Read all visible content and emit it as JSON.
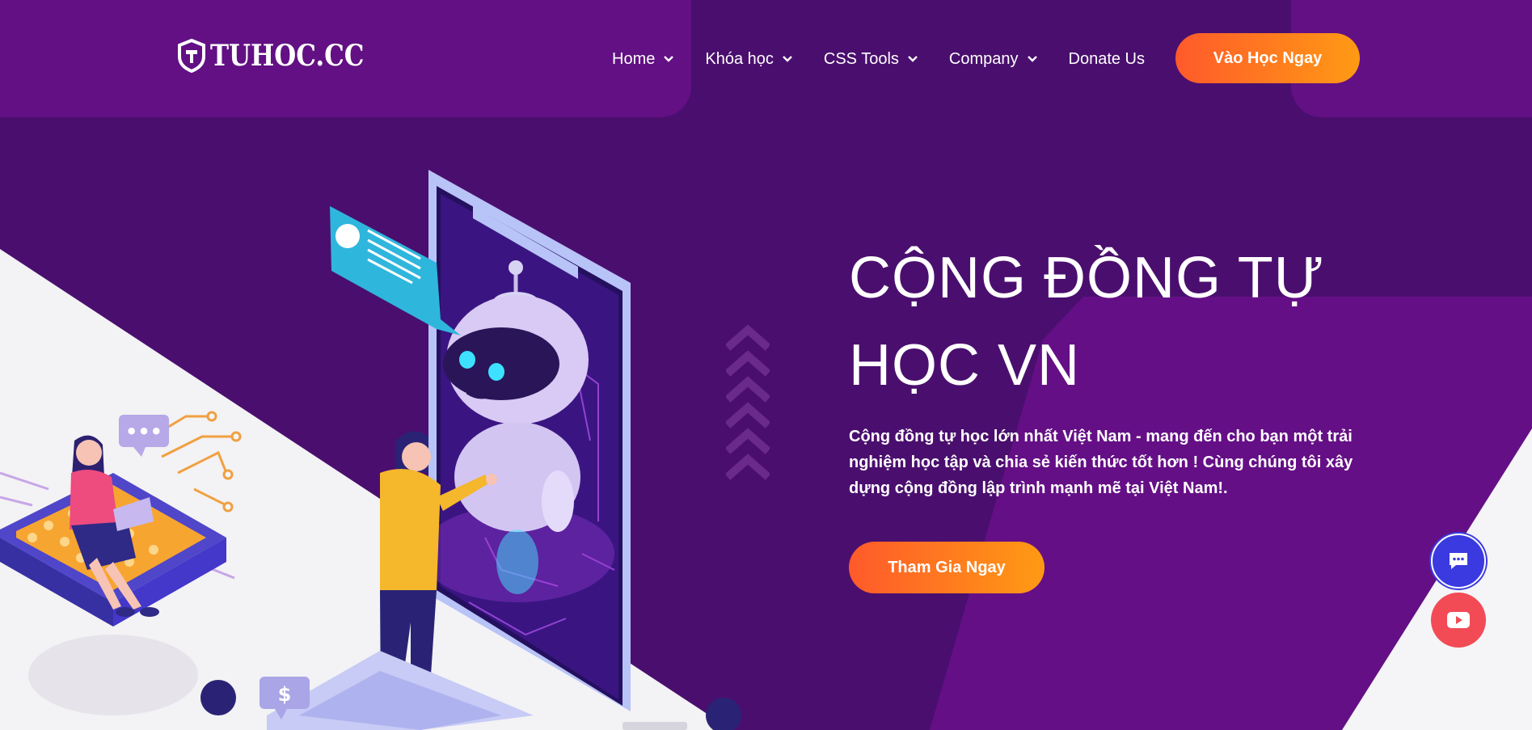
{
  "brand": {
    "logo_text": "TUHOC.CC"
  },
  "nav": {
    "items": [
      {
        "label": "Home",
        "has_dropdown": true
      },
      {
        "label": "Khóa học",
        "has_dropdown": true
      },
      {
        "label": "CSS Tools",
        "has_dropdown": true
      },
      {
        "label": "Company",
        "has_dropdown": true
      },
      {
        "label": "Donate Us",
        "has_dropdown": false
      }
    ],
    "cta_label": "Vào Học Ngay"
  },
  "hero": {
    "title": "CỘNG ĐỒNG TỰ HỌC VN",
    "description": "Cộng đồng tự học lớn nhất Việt Nam - mang đến cho bạn một trải nghiệm học tập và chia sẻ kiến thức tốt hơn ! Cùng chúng tôi xây dựng cộng đồng lập trình mạnh mẽ tại Việt Nam!.",
    "cta_label": "Tham Gia Ngay"
  },
  "illustration": {
    "price_tag": "$",
    "chat_bubble": "•••"
  },
  "floating": {
    "chat_icon": "chat-icon",
    "youtube_icon": "youtube-icon"
  },
  "colors": {
    "background": "#4a0f6e",
    "header_block": "#621084",
    "accent_start": "#ff5a2a",
    "accent_end": "#ff9a14",
    "chat_button": "#3a3ae0",
    "youtube_button": "#f24b55"
  }
}
